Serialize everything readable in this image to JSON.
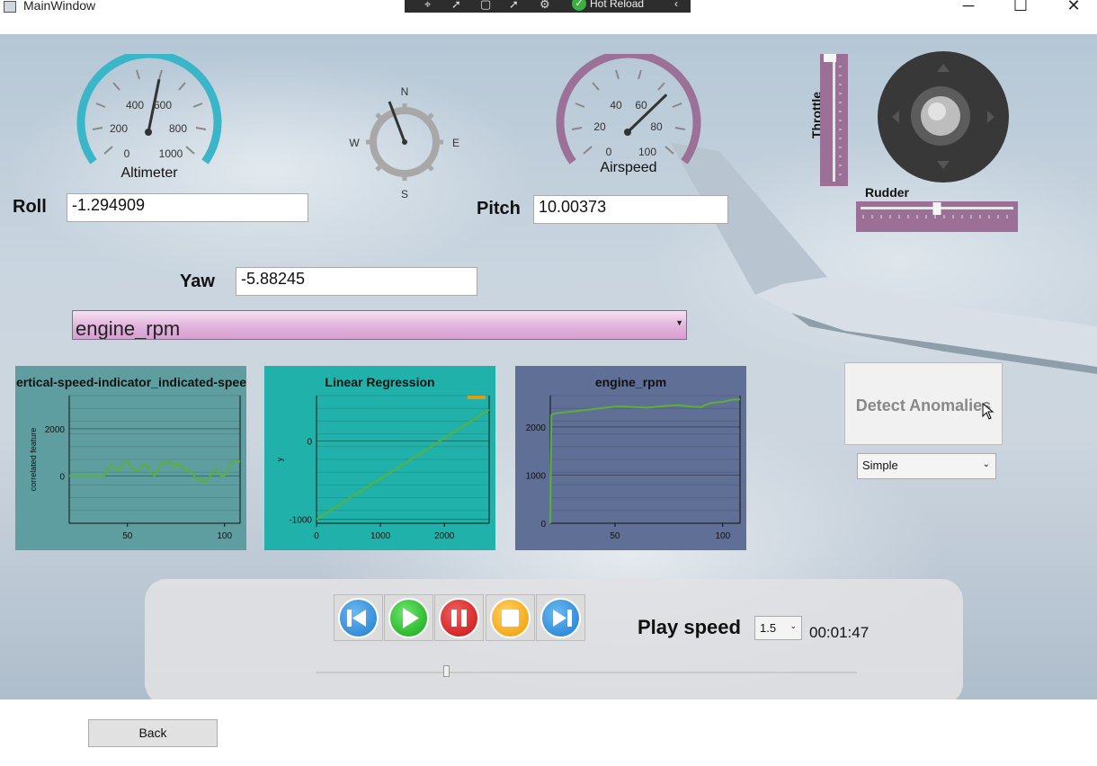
{
  "window": {
    "title": "MainWindow",
    "hot_reload_label": "Hot Reload",
    "minimize": "─",
    "maximize": "☐",
    "close": "✕"
  },
  "gauges": {
    "altimeter": {
      "label": "Altimeter",
      "ticks": [
        "0",
        "200",
        "400",
        "600",
        "800",
        "1000"
      ],
      "value_fraction": 0.55
    },
    "compass": {
      "north": "N",
      "east": "E",
      "south": "S",
      "west": "W"
    },
    "airspeed": {
      "label": "Airspeed",
      "ticks": [
        "0",
        "20",
        "40",
        "60",
        "80",
        "100"
      ],
      "value_fraction": 0.7
    }
  },
  "fields": {
    "roll_label": "Roll",
    "roll_value": "-1.294909",
    "pitch_label": "Pitch",
    "pitch_value": "10.00373",
    "yaw_label": "Yaw",
    "yaw_value": "-5.88245"
  },
  "feature_select": {
    "value": "engine_rpm"
  },
  "controls": {
    "throttle_label": "Throttle",
    "rudder_label": "Rudder",
    "throttle_level": 1.0,
    "rudder_level": 0.5
  },
  "chart_data": [
    {
      "type": "line",
      "title": "ertical-speed-indicator_indicated-spee",
      "ylabel": "correlated feature",
      "xlabel": "",
      "x_ticks": [
        50,
        100
      ],
      "y_ticks": [
        0,
        2000
      ],
      "xlim": [
        20,
        108
      ],
      "ylim": [
        -2000,
        3400
      ],
      "series": [
        {
          "values_x": [
            20,
            25,
            30,
            35,
            38,
            40,
            42,
            45,
            48,
            50,
            52,
            55,
            58,
            60,
            62,
            64,
            66,
            68,
            70,
            72,
            74,
            76,
            78,
            80,
            82,
            84,
            86,
            88,
            90,
            92,
            94,
            96,
            98,
            100,
            102,
            104,
            106,
            108
          ],
          "values_y": [
            0,
            0,
            0,
            0,
            0,
            300,
            500,
            200,
            550,
            650,
            300,
            200,
            450,
            500,
            100,
            0,
            300,
            600,
            500,
            650,
            350,
            550,
            400,
            200,
            250,
            50,
            -200,
            -100,
            -300,
            -100,
            200,
            300,
            0,
            0,
            300,
            600,
            650,
            600
          ]
        }
      ]
    },
    {
      "type": "line",
      "title": "Linear Regression",
      "ylabel": "y",
      "xlabel": "",
      "x_ticks": [
        0,
        1000,
        2000
      ],
      "y_ticks": [
        -1000,
        0
      ],
      "xlim": [
        0,
        2700
      ],
      "ylim": [
        -1050,
        580
      ],
      "series": [
        {
          "values_x": [
            0,
            2700
          ],
          "values_y": [
            -1000,
            400
          ]
        }
      ]
    },
    {
      "type": "line",
      "title": "engine_rpm",
      "ylabel": "",
      "xlabel": "",
      "x_ticks": [
        50,
        100
      ],
      "y_ticks": [
        0,
        1000,
        2000
      ],
      "xlim": [
        20,
        108
      ],
      "ylim": [
        0,
        2650
      ],
      "series": [
        {
          "values_x": [
            20,
            20.5,
            22,
            30,
            40,
            50,
            55,
            60,
            65,
            70,
            75,
            80,
            85,
            90,
            92,
            95,
            100,
            104,
            108
          ],
          "values_y": [
            0,
            2250,
            2280,
            2320,
            2370,
            2420,
            2420,
            2410,
            2400,
            2420,
            2440,
            2450,
            2420,
            2410,
            2460,
            2500,
            2520,
            2560,
            2570
          ]
        }
      ]
    }
  ],
  "detect": {
    "label": "Detect Anomalies",
    "algorithm": "Simple"
  },
  "playback": {
    "speed_label": "Play speed",
    "speed_value": "1.5",
    "time": "00:01:47",
    "progress": 0.24
  },
  "back_label": "Back"
}
